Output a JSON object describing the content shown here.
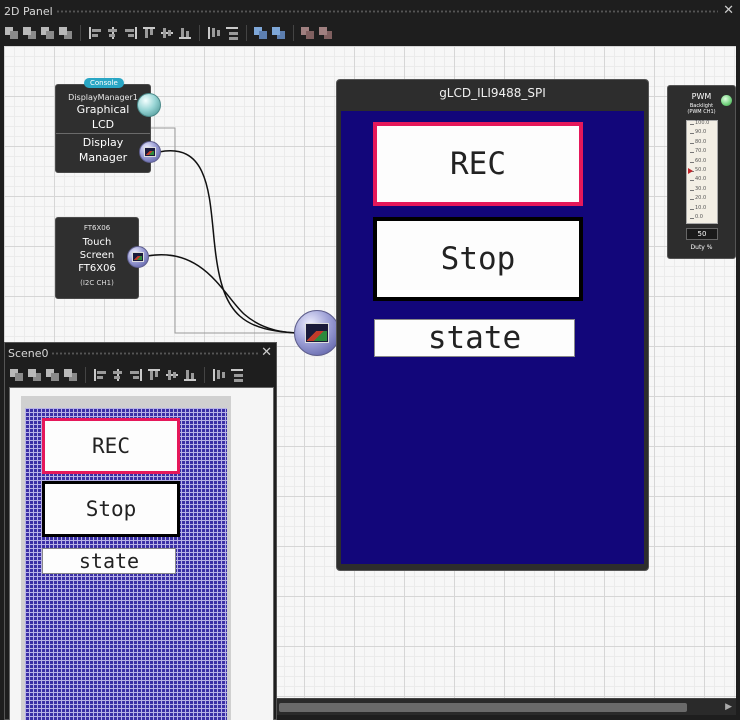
{
  "panel": {
    "title": "2D Panel",
    "close_glyph": "✕"
  },
  "toolbar": {
    "icons": [
      "bring-front-icon",
      "send-back-icon",
      "bring-forward-icon",
      "send-backward-icon",
      "align-left-icon",
      "align-center-icon",
      "align-right-icon",
      "align-top-icon",
      "align-middle-icon",
      "align-bottom-icon",
      "distribute-horizontal-icon",
      "distribute-vertical-icon",
      "group-icon",
      "ungroup-icon",
      "lock-icon",
      "unlock-icon"
    ]
  },
  "nodes": {
    "display_manager": {
      "badge": "Console",
      "header": "DisplayManager1",
      "line1": "Graphical",
      "line2": "LCD",
      "line3": "Display",
      "line4": "Manager"
    },
    "touch": {
      "header": "FT6X06",
      "line1": "Touch",
      "line2": "Screen",
      "line3": "FT6X06",
      "sub": "(I2C CH1)"
    }
  },
  "lcd": {
    "title": "gLCD_ILI9488_SPI",
    "widgets": {
      "rec": "REC",
      "stop": "Stop",
      "state": "state"
    },
    "screen_color": "#12067a"
  },
  "pwm": {
    "title": "PWM",
    "subtitle": "Backlight",
    "channel": "(PWM CH1)",
    "ticks": [
      "100.0",
      "90.0",
      "80.0",
      "70.0",
      "60.0",
      "50.0",
      "40.0",
      "30.0",
      "20.0",
      "10.0",
      "0.0"
    ],
    "value": "50",
    "unit_label": "Duty %",
    "level_percent": 50
  },
  "scene": {
    "title": "Scene0",
    "close_glyph": "✕",
    "widgets": {
      "rec": "REC",
      "stop": "Stop",
      "state": "state"
    }
  },
  "colors": {
    "accent_pink": "#e5185a",
    "screen_blue": "#12067a",
    "badge": "#29a6c4"
  }
}
